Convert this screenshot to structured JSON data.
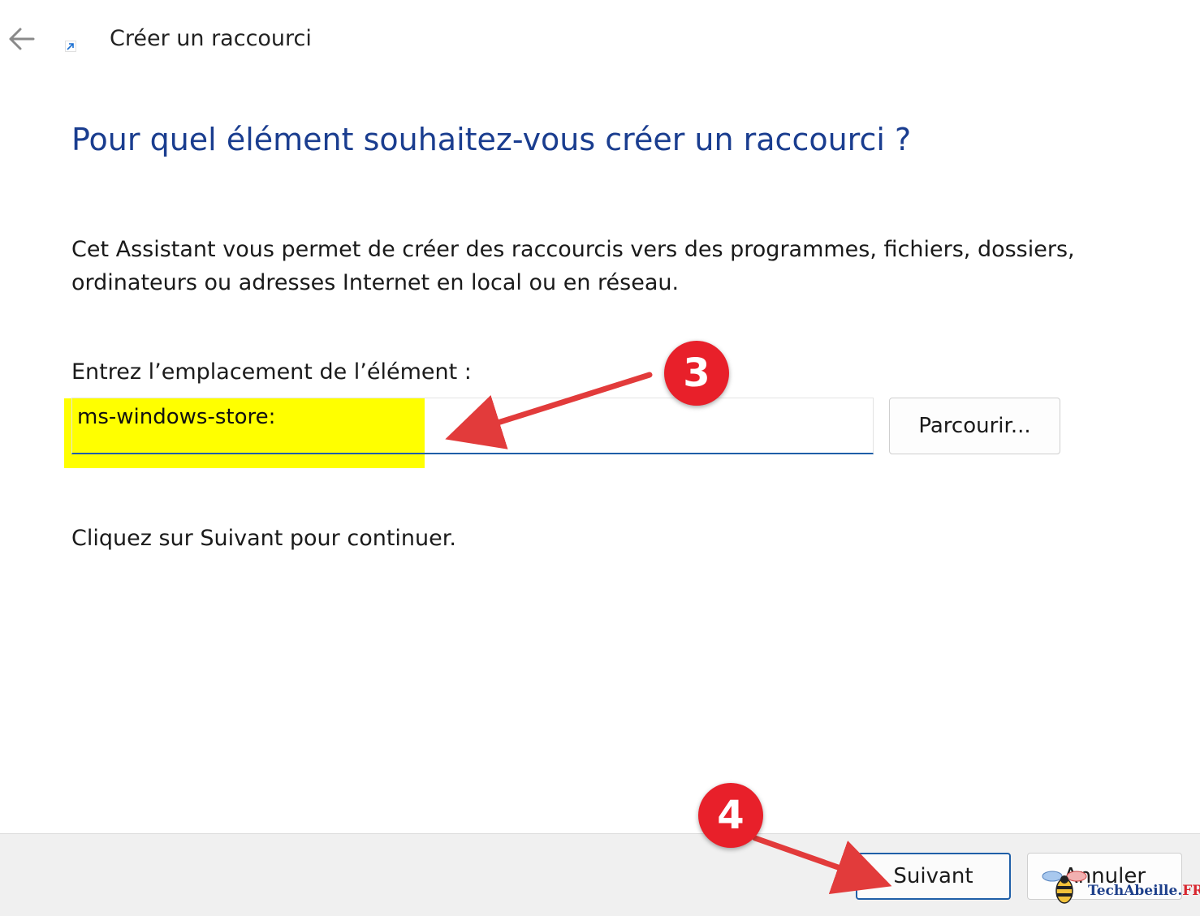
{
  "window": {
    "title": "Créer un raccourci",
    "back_icon": "arrow-left-icon",
    "app_icon": "shortcut-arrow-icon"
  },
  "content": {
    "heading": "Pour quel élément souhaitez-vous créer un raccourci ?",
    "intro_line1": "Cet Assistant vous permet de créer des raccourcis vers des programmes, fichiers, dossiers,",
    "intro_line2": "ordinateurs ou adresses Internet en local ou en réseau.",
    "field_label": "Entrez l’emplacement de l’élément :",
    "location_value": "ms-windows-store:",
    "browse_label": "Parcourir...",
    "continue_text": "Cliquez sur Suivant pour continuer."
  },
  "footer": {
    "next_label": "Suivant",
    "cancel_label": "Annuler"
  },
  "annotations": {
    "badge_1": "3",
    "badge_2": "4",
    "highlight_color": "#ffff00",
    "badge_color": "#e8202a",
    "arrow_color": "#e23b3b"
  },
  "watermark": {
    "name": "TechAbeille",
    "dot": ".",
    "tld": "FR",
    "icon": "bee-icon"
  },
  "colors": {
    "heading": "#1a3d8f",
    "accent": "#1f5fa8",
    "footer_bg": "#f0f0f0"
  }
}
